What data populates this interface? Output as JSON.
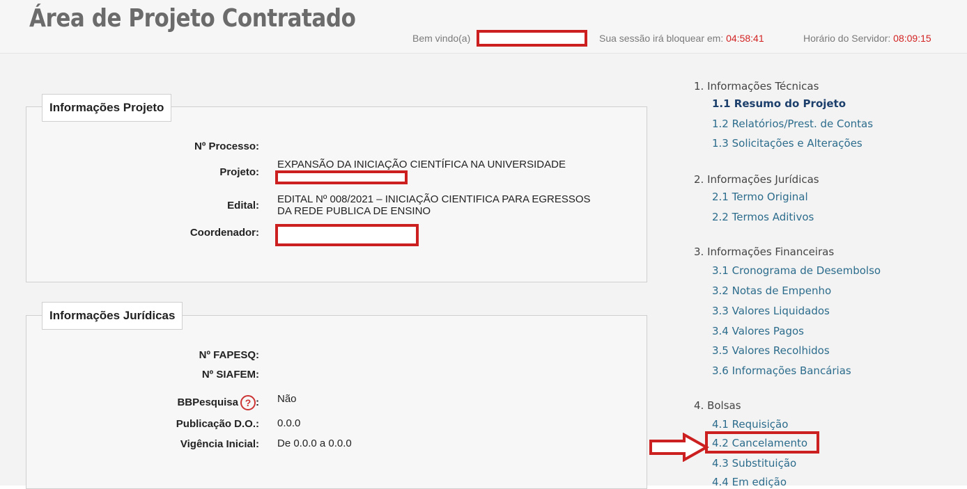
{
  "header": {
    "title": "Área de Projeto Contratado",
    "welcome_label": "Bem vindo(a)",
    "session_label": "Sua sessão irá bloquear em:",
    "session_time": "04:58:41",
    "server_label": "Horário do Servidor:",
    "server_time": "08:09:15"
  },
  "project_panel": {
    "legend": "Informações Projeto",
    "fields": {
      "processo_label": "Nº Processo:",
      "projeto_label": "Projeto:",
      "projeto_value": "EXPANSÃO DA INICIAÇÃO CIENTÍFICA NA UNIVERSIDADE",
      "edital_label": "Edital:",
      "edital_value_line1": "EDITAL Nº 008/2021 – INICIAÇÃO CIENTIFICA PARA EGRESSOS",
      "edital_value_line2": "DA REDE PUBLICA DE ENSINO",
      "coordenador_label": "Coordenador:"
    }
  },
  "legal_panel": {
    "legend": "Informações Jurídicas",
    "fields": {
      "fapesq_label": "Nº FAPESQ:",
      "siafem_label": "Nº SIAFEM:",
      "bbpesquisa_label": "BBPesquisa",
      "bbpesquisa_colon": ":",
      "bbpesquisa_value": "Não",
      "help_icon_glyph": "?",
      "publicacao_label": "Publicação D.O.:",
      "publicacao_value": "0.0.0",
      "vigencia_label": "Vigência Inicial:",
      "vigencia_value": "De 0.0.0 a 0.0.0"
    }
  },
  "sidebar": {
    "sections": [
      {
        "title": "1. Informações Técnicas",
        "items": [
          {
            "label": "1.1 Resumo do Projeto",
            "active": true
          },
          {
            "label": "1.2 Relatórios/Prest. de Contas"
          },
          {
            "label": "1.3 Solicitações e Alterações"
          }
        ]
      },
      {
        "title": "2. Informações Jurídicas",
        "items": [
          {
            "label": "2.1 Termo Original"
          },
          {
            "label": "2.2 Termos Aditivos"
          }
        ]
      },
      {
        "title": "3. Informações Financeiras",
        "items": [
          {
            "label": "3.1 Cronograma de Desembolso"
          },
          {
            "label": "3.2 Notas de Empenho"
          },
          {
            "label": "3.3 Valores Liquidados"
          },
          {
            "label": "3.4 Valores Pagos"
          },
          {
            "label": "3.5 Valores Recolhidos"
          },
          {
            "label": "3.6 Informações Bancárias"
          }
        ]
      },
      {
        "title": "4. Bolsas",
        "items": [
          {
            "label": "4.1 Requisição"
          },
          {
            "label": "4.2 Cancelamento",
            "highlighted": true
          },
          {
            "label": "4.3 Substituição"
          },
          {
            "label": "4.4 Em edição"
          }
        ]
      }
    ]
  },
  "colors": {
    "accent_red": "#d32222",
    "link_blue": "#2c6c8c",
    "active_link": "#1c3f6b"
  }
}
